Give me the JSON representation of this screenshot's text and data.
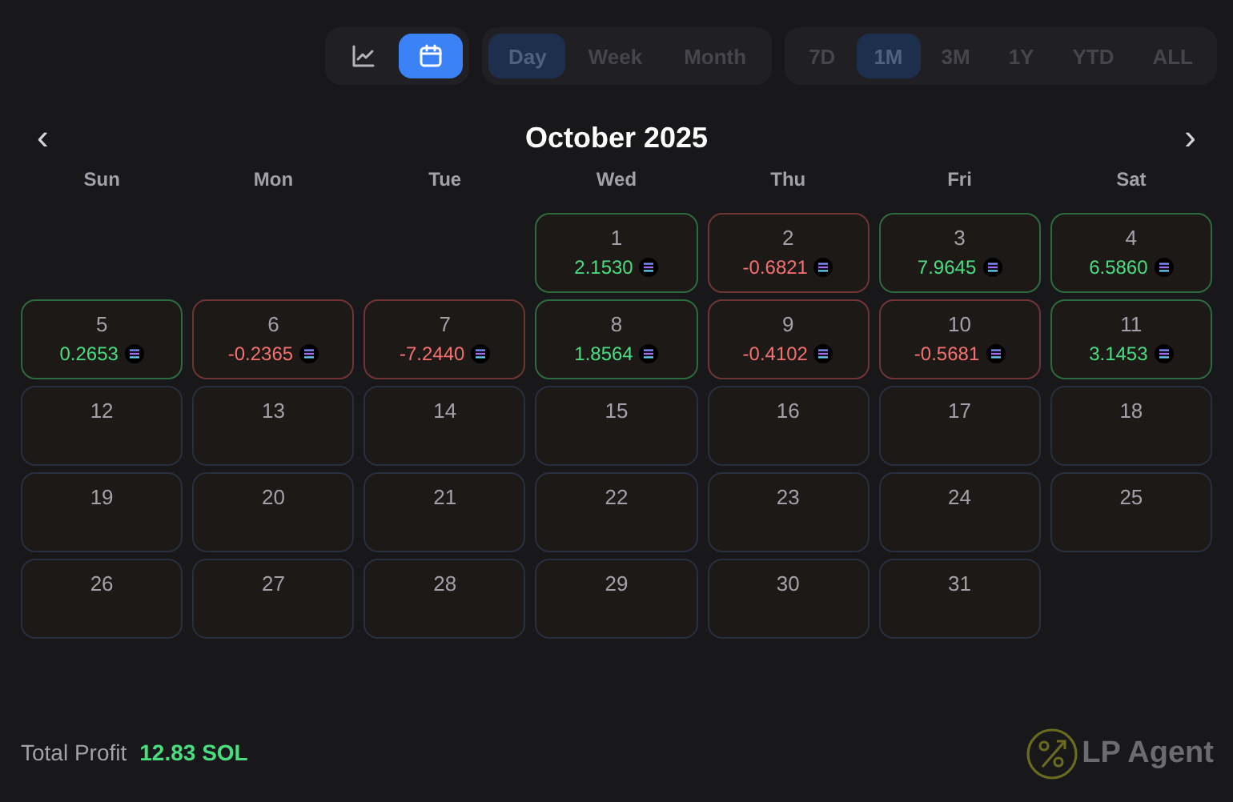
{
  "view_toggle": [
    {
      "kind": "chart",
      "selected": false
    },
    {
      "kind": "calendar",
      "selected": true
    }
  ],
  "granularity_tabs": [
    {
      "label": "Day",
      "selected": true
    },
    {
      "label": "Week",
      "selected": false
    },
    {
      "label": "Month",
      "selected": false
    }
  ],
  "period_tabs": [
    {
      "label": "7D",
      "selected": false
    },
    {
      "label": "1M",
      "selected": true
    },
    {
      "label": "3M",
      "selected": false
    },
    {
      "label": "1Y",
      "selected": false
    },
    {
      "label": "YTD",
      "selected": false
    },
    {
      "label": "ALL",
      "selected": false
    }
  ],
  "calendar": {
    "prev": "‹",
    "title": "October 2025",
    "next": "›",
    "weekdays": [
      "Sun",
      "Mon",
      "Tue",
      "Wed",
      "Thu",
      "Fri",
      "Sat"
    ],
    "weeks": [
      {
        "days": [
          {
            "kind": "empty"
          },
          {
            "kind": "empty"
          },
          {
            "kind": "empty"
          },
          {
            "kind": "gain",
            "day": "1",
            "profit": "2.1530"
          },
          {
            "kind": "loss",
            "day": "2",
            "profit": "-0.6821"
          },
          {
            "kind": "gain",
            "day": "3",
            "profit": "7.9645"
          },
          {
            "kind": "gain",
            "day": "4",
            "profit": "6.5860"
          }
        ]
      },
      {
        "days": [
          {
            "kind": "gain",
            "day": "5",
            "profit": "0.2653"
          },
          {
            "kind": "loss",
            "day": "6",
            "profit": "-0.2365"
          },
          {
            "kind": "loss",
            "day": "7",
            "profit": "-7.2440"
          },
          {
            "kind": "gain",
            "day": "8",
            "profit": "1.8564"
          },
          {
            "kind": "loss",
            "day": "9",
            "profit": "-0.4102"
          },
          {
            "kind": "loss",
            "day": "10",
            "profit": "-0.5681"
          },
          {
            "kind": "gain",
            "day": "11",
            "profit": "3.1453"
          }
        ]
      },
      {
        "days": [
          {
            "kind": "blank",
            "day": "12"
          },
          {
            "kind": "blank",
            "day": "13"
          },
          {
            "kind": "blank",
            "day": "14"
          },
          {
            "kind": "blank",
            "day": "15"
          },
          {
            "kind": "blank",
            "day": "16"
          },
          {
            "kind": "blank",
            "day": "17"
          },
          {
            "kind": "blank",
            "day": "18"
          }
        ]
      },
      {
        "days": [
          {
            "kind": "blank",
            "day": "19"
          },
          {
            "kind": "blank",
            "day": "20"
          },
          {
            "kind": "blank",
            "day": "21"
          },
          {
            "kind": "blank",
            "day": "22"
          },
          {
            "kind": "blank",
            "day": "23"
          },
          {
            "kind": "blank",
            "day": "24"
          },
          {
            "kind": "blank",
            "day": "25"
          }
        ]
      },
      {
        "days": [
          {
            "kind": "blank",
            "day": "26"
          },
          {
            "kind": "blank",
            "day": "27"
          },
          {
            "kind": "blank",
            "day": "28"
          },
          {
            "kind": "blank",
            "day": "29"
          },
          {
            "kind": "blank",
            "day": "30"
          },
          {
            "kind": "blank",
            "day": "31"
          },
          {
            "kind": "empty"
          }
        ]
      }
    ]
  },
  "total_profit": {
    "label": "Total Profit",
    "value": "12.83 SOL"
  },
  "logo": {
    "text": "LP Agent"
  }
}
